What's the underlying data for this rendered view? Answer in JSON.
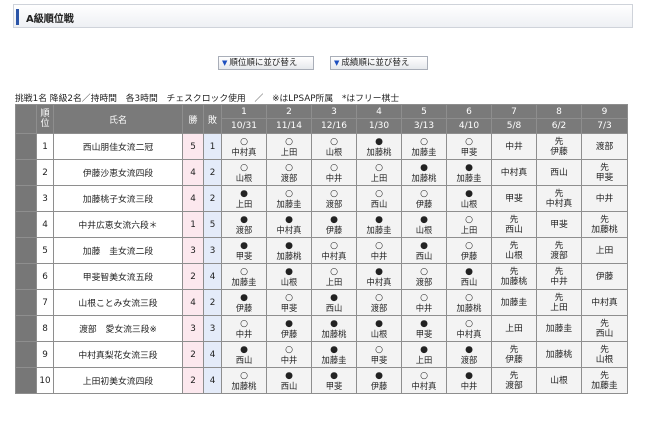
{
  "header": {
    "title": "A級順位戦"
  },
  "buttons": {
    "rank_sort": "順位順に並び替え",
    "score_sort": "成績順に並び替え"
  },
  "notice": "挑戦1名 降級2名／持時間　各3時間　チェスクロック使用　／　※はLPSAP所属　*はフリー棋士",
  "columns": {
    "rank": "順位",
    "name": "氏名",
    "wins": "勝",
    "losses": "敗",
    "rounds": [
      {
        "no": "1",
        "date": "10/31"
      },
      {
        "no": "2",
        "date": "11/14"
      },
      {
        "no": "3",
        "date": "12/16"
      },
      {
        "no": "4",
        "date": "1/30"
      },
      {
        "no": "5",
        "date": "3/13"
      },
      {
        "no": "6",
        "date": "4/10"
      },
      {
        "no": "7",
        "date": "5/8"
      },
      {
        "no": "8",
        "date": "6/2"
      },
      {
        "no": "9",
        "date": "7/3"
      }
    ]
  },
  "rows": [
    {
      "rank": "1",
      "name": "西山朋佳女流二冠",
      "wins": "5",
      "losses": "1",
      "games": [
        {
          "r": "○",
          "o": "中村真"
        },
        {
          "r": "○",
          "o": "上田"
        },
        {
          "r": "○",
          "o": "山根"
        },
        {
          "r": "●",
          "o": "加藤桃"
        },
        {
          "r": "○",
          "o": "加藤圭"
        },
        {
          "r": "○",
          "o": "甲斐"
        },
        {
          "r": "",
          "o": "中井"
        },
        {
          "r": "",
          "o": "先\n伊藤"
        },
        {
          "r": "",
          "o": "渡部"
        }
      ]
    },
    {
      "rank": "2",
      "name": "伊藤沙恵女流四段",
      "wins": "4",
      "losses": "2",
      "games": [
        {
          "r": "○",
          "o": "山根"
        },
        {
          "r": "○",
          "o": "渡部"
        },
        {
          "r": "○",
          "o": "中井"
        },
        {
          "r": "○",
          "o": "上田"
        },
        {
          "r": "●",
          "o": "加藤桃"
        },
        {
          "r": "●",
          "o": "加藤圭"
        },
        {
          "r": "",
          "o": "中村真"
        },
        {
          "r": "",
          "o": "西山"
        },
        {
          "r": "",
          "o": "先\n甲斐"
        }
      ]
    },
    {
      "rank": "3",
      "name": "加藤桃子女流三段",
      "wins": "4",
      "losses": "2",
      "games": [
        {
          "r": "●",
          "o": "上田"
        },
        {
          "r": "○",
          "o": "加藤圭"
        },
        {
          "r": "○",
          "o": "渡部"
        },
        {
          "r": "○",
          "o": "西山"
        },
        {
          "r": "○",
          "o": "伊藤"
        },
        {
          "r": "●",
          "o": "山根"
        },
        {
          "r": "",
          "o": "甲斐"
        },
        {
          "r": "",
          "o": "先\n中村真"
        },
        {
          "r": "",
          "o": "中井"
        }
      ]
    },
    {
      "rank": "4",
      "name": "中井広恵女流六段＊",
      "wins": "1",
      "losses": "5",
      "games": [
        {
          "r": "●",
          "o": "渡部"
        },
        {
          "r": "●",
          "o": "中村真"
        },
        {
          "r": "●",
          "o": "伊藤"
        },
        {
          "r": "●",
          "o": "加藤圭"
        },
        {
          "r": "●",
          "o": "山根"
        },
        {
          "r": "○",
          "o": "上田"
        },
        {
          "r": "",
          "o": "先\n西山"
        },
        {
          "r": "",
          "o": "甲斐"
        },
        {
          "r": "",
          "o": "先\n加藤桃"
        }
      ]
    },
    {
      "rank": "5",
      "name": "加藤　圭女流二段",
      "wins": "3",
      "losses": "3",
      "games": [
        {
          "r": "●",
          "o": "甲斐"
        },
        {
          "r": "●",
          "o": "加藤桃"
        },
        {
          "r": "○",
          "o": "中村真"
        },
        {
          "r": "○",
          "o": "中井"
        },
        {
          "r": "●",
          "o": "西山"
        },
        {
          "r": "○",
          "o": "伊藤"
        },
        {
          "r": "",
          "o": "先\n山根"
        },
        {
          "r": "",
          "o": "先\n渡部"
        },
        {
          "r": "",
          "o": "上田"
        }
      ]
    },
    {
      "rank": "6",
      "name": "甲斐智美女流五段",
      "wins": "2",
      "losses": "4",
      "games": [
        {
          "r": "○",
          "o": "加藤圭"
        },
        {
          "r": "●",
          "o": "山根"
        },
        {
          "r": "○",
          "o": "上田"
        },
        {
          "r": "●",
          "o": "中村真"
        },
        {
          "r": "○",
          "o": "渡部"
        },
        {
          "r": "●",
          "o": "西山"
        },
        {
          "r": "",
          "o": "先\n加藤桃"
        },
        {
          "r": "",
          "o": "先\n中井"
        },
        {
          "r": "",
          "o": "伊藤"
        }
      ]
    },
    {
      "rank": "7",
      "name": "山根ことみ女流三段",
      "wins": "4",
      "losses": "2",
      "games": [
        {
          "r": "●",
          "o": "伊藤"
        },
        {
          "r": "○",
          "o": "甲斐"
        },
        {
          "r": "●",
          "o": "西山"
        },
        {
          "r": "○",
          "o": "渡部"
        },
        {
          "r": "○",
          "o": "中井"
        },
        {
          "r": "○",
          "o": "加藤桃"
        },
        {
          "r": "",
          "o": "加藤圭"
        },
        {
          "r": "",
          "o": "先\n上田"
        },
        {
          "r": "",
          "o": "中村真"
        }
      ]
    },
    {
      "rank": "8",
      "name": "渡部　愛女流三段※",
      "wins": "3",
      "losses": "3",
      "games": [
        {
          "r": "○",
          "o": "中井"
        },
        {
          "r": "●",
          "o": "伊藤"
        },
        {
          "r": "●",
          "o": "加藤桃"
        },
        {
          "r": "●",
          "o": "山根"
        },
        {
          "r": "●",
          "o": "甲斐"
        },
        {
          "r": "○",
          "o": "中村真"
        },
        {
          "r": "",
          "o": "上田"
        },
        {
          "r": "",
          "o": "加藤圭"
        },
        {
          "r": "",
          "o": "先\n西山"
        }
      ]
    },
    {
      "rank": "9",
      "name": "中村真梨花女流三段",
      "wins": "2",
      "losses": "4",
      "games": [
        {
          "r": "●",
          "o": "西山"
        },
        {
          "r": "○",
          "o": "中井"
        },
        {
          "r": "●",
          "o": "加藤圭"
        },
        {
          "r": "○",
          "o": "甲斐"
        },
        {
          "r": "●",
          "o": "上田"
        },
        {
          "r": "●",
          "o": "渡部"
        },
        {
          "r": "",
          "o": "先\n伊藤"
        },
        {
          "r": "",
          "o": "加藤桃"
        },
        {
          "r": "",
          "o": "先\n山根"
        }
      ]
    },
    {
      "rank": "10",
      "name": "上田初美女流四段",
      "wins": "2",
      "losses": "4",
      "games": [
        {
          "r": "○",
          "o": "加藤桃"
        },
        {
          "r": "●",
          "o": "西山"
        },
        {
          "r": "●",
          "o": "甲斐"
        },
        {
          "r": "●",
          "o": "伊藤"
        },
        {
          "r": "○",
          "o": "中村真"
        },
        {
          "r": "●",
          "o": "中井"
        },
        {
          "r": "",
          "o": "先\n渡部"
        },
        {
          "r": "",
          "o": "山根"
        },
        {
          "r": "",
          "o": "先\n加藤圭"
        }
      ]
    }
  ]
}
